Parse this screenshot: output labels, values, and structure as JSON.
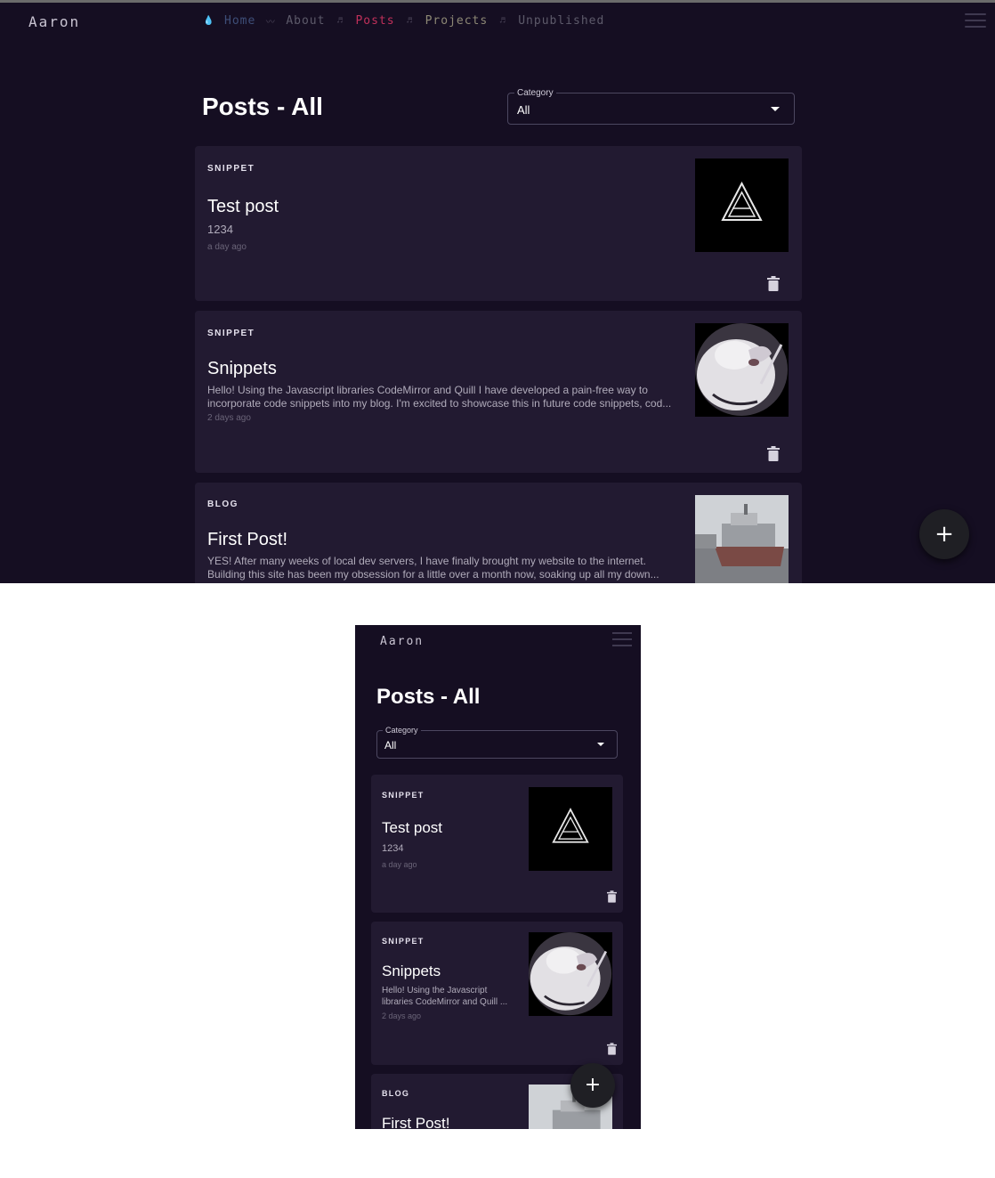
{
  "brand": "Aaron",
  "nav": {
    "items": [
      {
        "icon": "drop-icon",
        "glyph": "💧",
        "label": "Home"
      },
      {
        "icon": "wave-icon",
        "glyph": "〰",
        "label": "About"
      },
      {
        "icon": "music-note-icon",
        "glyph": "♬",
        "label": "Posts"
      },
      {
        "icon": "music-note-icon",
        "glyph": "♬",
        "label": "Projects"
      },
      {
        "icon": "music-note-icon",
        "glyph": "♬",
        "label": "Unpublished"
      }
    ],
    "active": "Posts"
  },
  "page": {
    "title": "Posts - All",
    "category": {
      "label": "Category",
      "value": "All"
    }
  },
  "posts": [
    {
      "type": "SNIPPET",
      "title": "Test post",
      "excerpt": "1234",
      "mobile_excerpt": "1234",
      "time": "a day ago",
      "thumb": "logo-a"
    },
    {
      "type": "SNIPPET",
      "title": "Snippets",
      "excerpt": "Hello! Using the Javascript libraries CodeMirror and Quill I have developed a pain-free way to incorporate code snippets into my blog. I'm excited to showcase this in future code snippets, cod...",
      "mobile_excerpt": "Hello! Using the Javascript libraries CodeMirror and Quill ...",
      "time": "2 days ago",
      "thumb": "mascot"
    },
    {
      "type": "BLOG",
      "title": "First Post!",
      "excerpt": "YES! After many weeks of local dev servers, I have finally brought my website to the internet. Building this site has been my obsession for a little over a month now, soaking up all my down...",
      "mobile_excerpt": "",
      "time": "",
      "thumb": "ship-photo"
    }
  ],
  "fab": {
    "label": "+",
    "icon": "plus-icon"
  },
  "colors": {
    "background": "#150e22",
    "card": "#221a31",
    "active_link": "#c0305a",
    "fab": "#1f1f24"
  }
}
